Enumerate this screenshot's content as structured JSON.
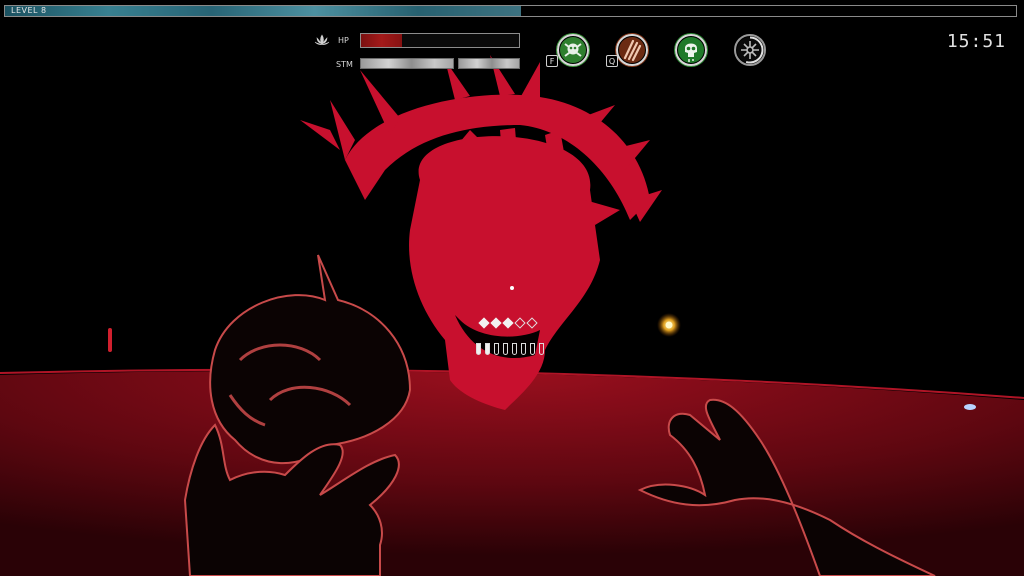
{
  "level": {
    "label": "LEVEL 8",
    "progress": 0.51
  },
  "timer": "15:51",
  "player": {
    "hp_label": "HP",
    "hp_icon": "lotus-icon",
    "hp_fraction": 0.26,
    "stm_label": "STM",
    "stm_segments": [
      1,
      1
    ]
  },
  "abilities": [
    {
      "name": "skull-crossbones-ability",
      "key": "F",
      "ring_color": "#3d9b3d",
      "icon": "skull-crossbones-icon"
    },
    {
      "name": "claw-strike-ability",
      "key": "Q",
      "ring_color": "#8a3a1c",
      "icon": "claw-slash-icon"
    },
    {
      "name": "poison-skull-ability",
      "key": "",
      "ring_color": "#2e8f36",
      "icon": "poison-skull-icon"
    },
    {
      "name": "sigil-ability",
      "key": "",
      "ring_color": "#1a1a1a",
      "icon": "chaos-sigil-icon",
      "cooldown": 0.55
    }
  ],
  "ammo": {
    "filled": 3,
    "empty": 2,
    "fangs": 8
  },
  "colors": {
    "enemy": "#c8102e",
    "floor": "#7a0a14",
    "hand": "#0b0303",
    "hand_outline": "#c84a4a",
    "background": "#000000"
  }
}
